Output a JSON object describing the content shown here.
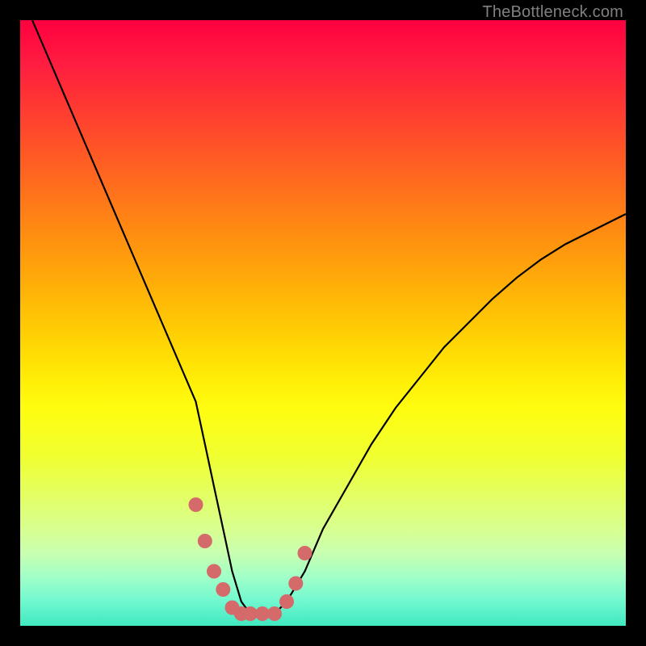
{
  "watermark": "TheBottleneck.com",
  "chart_data": {
    "type": "line",
    "title": "",
    "xlabel": "",
    "ylabel": "",
    "xlim": [
      0,
      100
    ],
    "ylim": [
      0,
      100
    ],
    "grid": false,
    "legend": false,
    "series": [
      {
        "name": "bottleneck-curve",
        "color": "#000000",
        "x": [
          2,
          5,
          8,
          11,
          14,
          17,
          20,
          23,
          26,
          29,
          30.5,
          32,
          33.5,
          35,
          36.5,
          38,
          40,
          42,
          44,
          47,
          50,
          54,
          58,
          62,
          66,
          70,
          74,
          78,
          82,
          86,
          90,
          94,
          98,
          100
        ],
        "y": [
          100,
          93,
          86,
          79,
          72,
          65,
          58,
          51,
          44,
          37,
          30,
          23,
          16,
          9,
          4,
          2,
          2,
          2,
          4,
          9,
          16,
          23,
          30,
          36,
          41,
          46,
          50,
          54,
          57.5,
          60.5,
          63,
          65,
          67,
          68
        ]
      },
      {
        "name": "highlight-markers",
        "color": "#d46a6a",
        "type": "scatter",
        "x": [
          29,
          30.5,
          32,
          33.5,
          35,
          36.5,
          38,
          40,
          42,
          44,
          45.5,
          47
        ],
        "y": [
          20,
          14,
          9,
          6,
          3,
          2,
          2,
          2,
          2,
          4,
          7,
          12
        ]
      }
    ],
    "background_gradient": {
      "direction": "vertical",
      "stops": [
        {
          "pos": 0,
          "color": "#ff0040"
        },
        {
          "pos": 50,
          "color": "#ffd004"
        },
        {
          "pos": 75,
          "color": "#f0ff30"
        },
        {
          "pos": 100,
          "color": "#40e8c0"
        }
      ]
    }
  }
}
